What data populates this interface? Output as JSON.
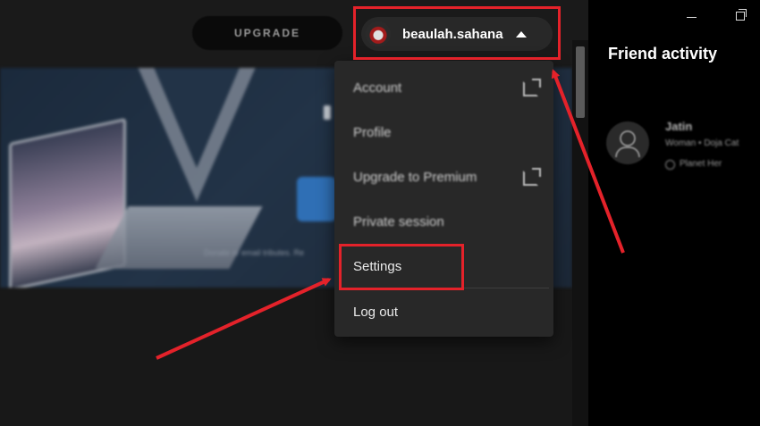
{
  "header": {
    "upgrade_label": "UPGRADE",
    "username": "beaulah.sahana"
  },
  "user_menu": {
    "items": [
      {
        "label": "Account",
        "external": true
      },
      {
        "label": "Profile",
        "external": false
      },
      {
        "label": "Upgrade to Premium",
        "external": true
      },
      {
        "label": "Private session",
        "external": false
      },
      {
        "label": "Settings",
        "external": false
      },
      {
        "label": "Log out",
        "external": false
      }
    ]
  },
  "friend_activity": {
    "title": "Friend activity",
    "friend": {
      "name": "Jatin",
      "song": "Woman • Doja Cat",
      "context": "Planet Her"
    }
  },
  "banner": {
    "caption": "Donate or email tributes. Re"
  },
  "annotation": {
    "highlight_color": "#e4222a"
  }
}
